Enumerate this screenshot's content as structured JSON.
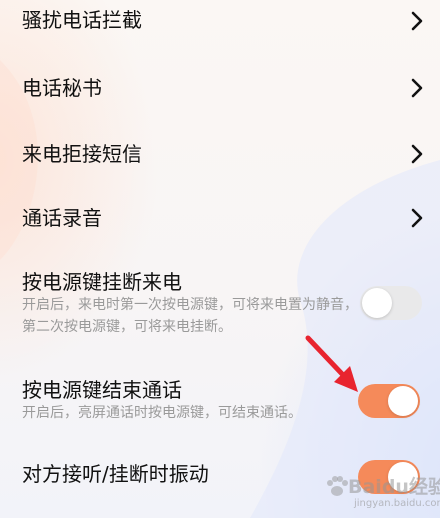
{
  "settings": {
    "items": [
      {
        "title": "骚扰电话拦截",
        "type": "link"
      },
      {
        "title": "电话秘书",
        "type": "link"
      },
      {
        "title": "来电拒接短信",
        "type": "link"
      },
      {
        "title": "通话录音",
        "type": "link"
      },
      {
        "title": "按电源键挂断来电",
        "type": "toggle",
        "desc": "开启后，来电时第一次按电源键，可将来电置为静音，第二次按电源键，可将来电挂断。",
        "on": false
      },
      {
        "title": "按电源键结束通话",
        "type": "toggle",
        "desc": "开启后，亮屏通话时按电源键，可结束通话。",
        "on": true
      },
      {
        "title": "对方接听/挂断时振动",
        "type": "toggle",
        "on": true
      }
    ]
  },
  "colors": {
    "accent": "#f58a5a",
    "annotation_arrow": "#e8242f",
    "desc_text": "#9a9a9a"
  },
  "watermark": {
    "text": "Baidu经验",
    "url": "jingyan.baidu.com"
  }
}
